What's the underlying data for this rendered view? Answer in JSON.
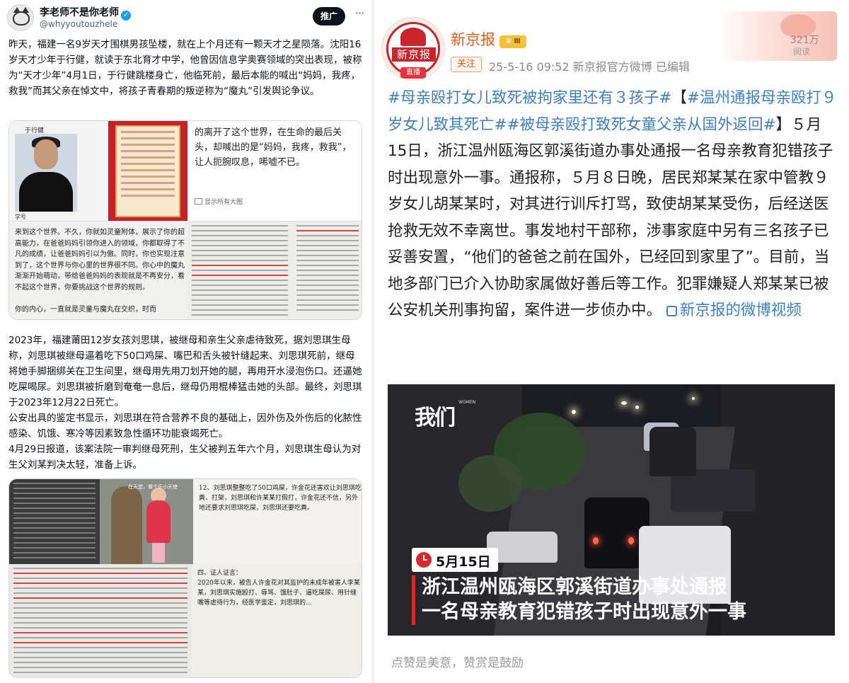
{
  "x_post": {
    "author_name": "李老师不是你老师",
    "verified_badge": "✓",
    "handle": "@whyyoutouzhele",
    "promote_label": "推广",
    "more_label": "···",
    "text1": "昨天，福建一名9岁天才围棋男孩坠楼，就在上个月还有一颗天才之星陨落。沈阳16岁天才少年于行健，就读于东北育才中学，他曾因信息学奥赛领域的突出表现，被称为“天才少年”4月1日，于行健跳楼身亡，他临死前，最后本能的喊出“妈妈，我疼，救我”而其父亲在悼文中，将孩子青春期的叛逆称为“魔丸”引发舆论争议。",
    "media1": {
      "boy_tag": "于行健",
      "boy_caption": "学号",
      "quote": "的离开了这个世界，在生命的最后关头，却喊出的是“妈妈，我疼，救我”，让人扼腕叹息，唏嘘不已。",
      "show_all": "显示所有大图",
      "doc_text": "来到这个世界。不久，你就如灵童附体，展示了你的超高能力，在爸爸妈妈引领你进入的领域，你都取得了不凡的成绩，让爸爸妈妈引以为傲。同时，你也实现注意到了，这个世界与你心里的世界很不同。你心中的魔丸渐渐开始萌动，带给爸爸妈妈的表现就是不再安分，看不起这个世界，你要挑战这个世界的规则。\n\n你的内心，一直就是灵童与魔丸在交织，时而"
    },
    "text2": "2023年，福建莆田12岁女孩刘思琪，被继母和亲生父亲虐待致死，据刘思琪生母称，刘思琪被继母逼着吃下50口鸡屎、嘴巴和舌头被针缝起来、刘思琪死前，继母将她手脚捆绑关在卫生间里，继母用先用刀划开她的腿，再用开水浸泡伤口。还逼她吃屎喝尿。刘思琪被折磨到奄奄一息后，继母仍用棍棒猛击她的头部。最终，刘思琪于2023年12月22日死亡。\n 公安出具的鉴定书显示，刘思琪在符合营养不良的基础上，因外伤及外伤后的化脓性感染、饥饿、寒冷等因素致急性循环功能衰竭死亡。\n4月29日报道，该案法院一审判继母死刑，生父被判五年六个月，刘思琪生母认为对生父刘某判决太轻，准备上诉。",
    "media2": {
      "photo_caption": "在天堂，做个乐小天使",
      "doc_text_top": "12、刘思琪整整吃了50口鸡屎，许金花还害欢让刘思琪吃粪、打架，刘思琪和许某某打假打，许金花还不信，另外地还要求刘思琪吃屎，刘思琪还要吃粪。",
      "doc_text_bottom": "四、证人证言：\n  2020年以来，被告人许金花对其监护的未成年被害人李某某，刘思琪实施殴打、辱骂、饿肚子、逼吃屎尿、用针缝嘴等虐待行为，经医学鉴定，刘思琪的..."
    }
  },
  "weibo_post": {
    "author_name": "新京报",
    "level_badge": "Ⅲ",
    "crown_icon": "♛",
    "logo_text": "新京报",
    "logo_live": "直播",
    "follow_label": "关注",
    "meta": "25-5-16 09:52  新京报官方微博  已编辑",
    "reads_count": "321万",
    "reads_label": "阅读",
    "tags": [
      "#母亲殴打女儿致死被拘家里还有３孩子#",
      "#温州通报母亲殴打９岁女儿致其死亡#",
      "#被母亲殴打致死女童父亲从国外返回#"
    ],
    "bracket_open": "【",
    "bracket_close": "】",
    "body": "５月15日，浙江温州瓯海区郭溪街道办事处通报一名母亲教育犯错孩子时出现意外一事。通报称，５月８日晚，居民郑某某在家中管教９岁女儿胡某某时，对其进行训斥打骂，致使胡某某受伤，后经送医抢救无效不幸离世。事发地村干部称，涉事家庭中另有三名孩子已妥善安置，“他们的爸爸之前在国外，已经回到家里了”。目前，当地多部门已介入协助家属做好善后等工作。犯罪嫌疑人郑某某已被公安机关刑事拘留，案件进一步侦办中。",
    "video_link": "新京报的微博视频",
    "video": {
      "channel_logo": "我们",
      "channel_sub": "WOMEN",
      "date": "5月15日",
      "caption_line1": "浙江温州瓯海区郭溪街道办事处通报",
      "caption_line2": "一名母亲教育犯错孩子时出现意外一事"
    },
    "footer": "点赞是美意，赞赏是鼓励"
  },
  "colors": {
    "weibo_orange": "#e45d1f",
    "weibo_link": "#3d80c7",
    "x_verified": "#1d9bf0",
    "news_red": "#d42a2a"
  }
}
